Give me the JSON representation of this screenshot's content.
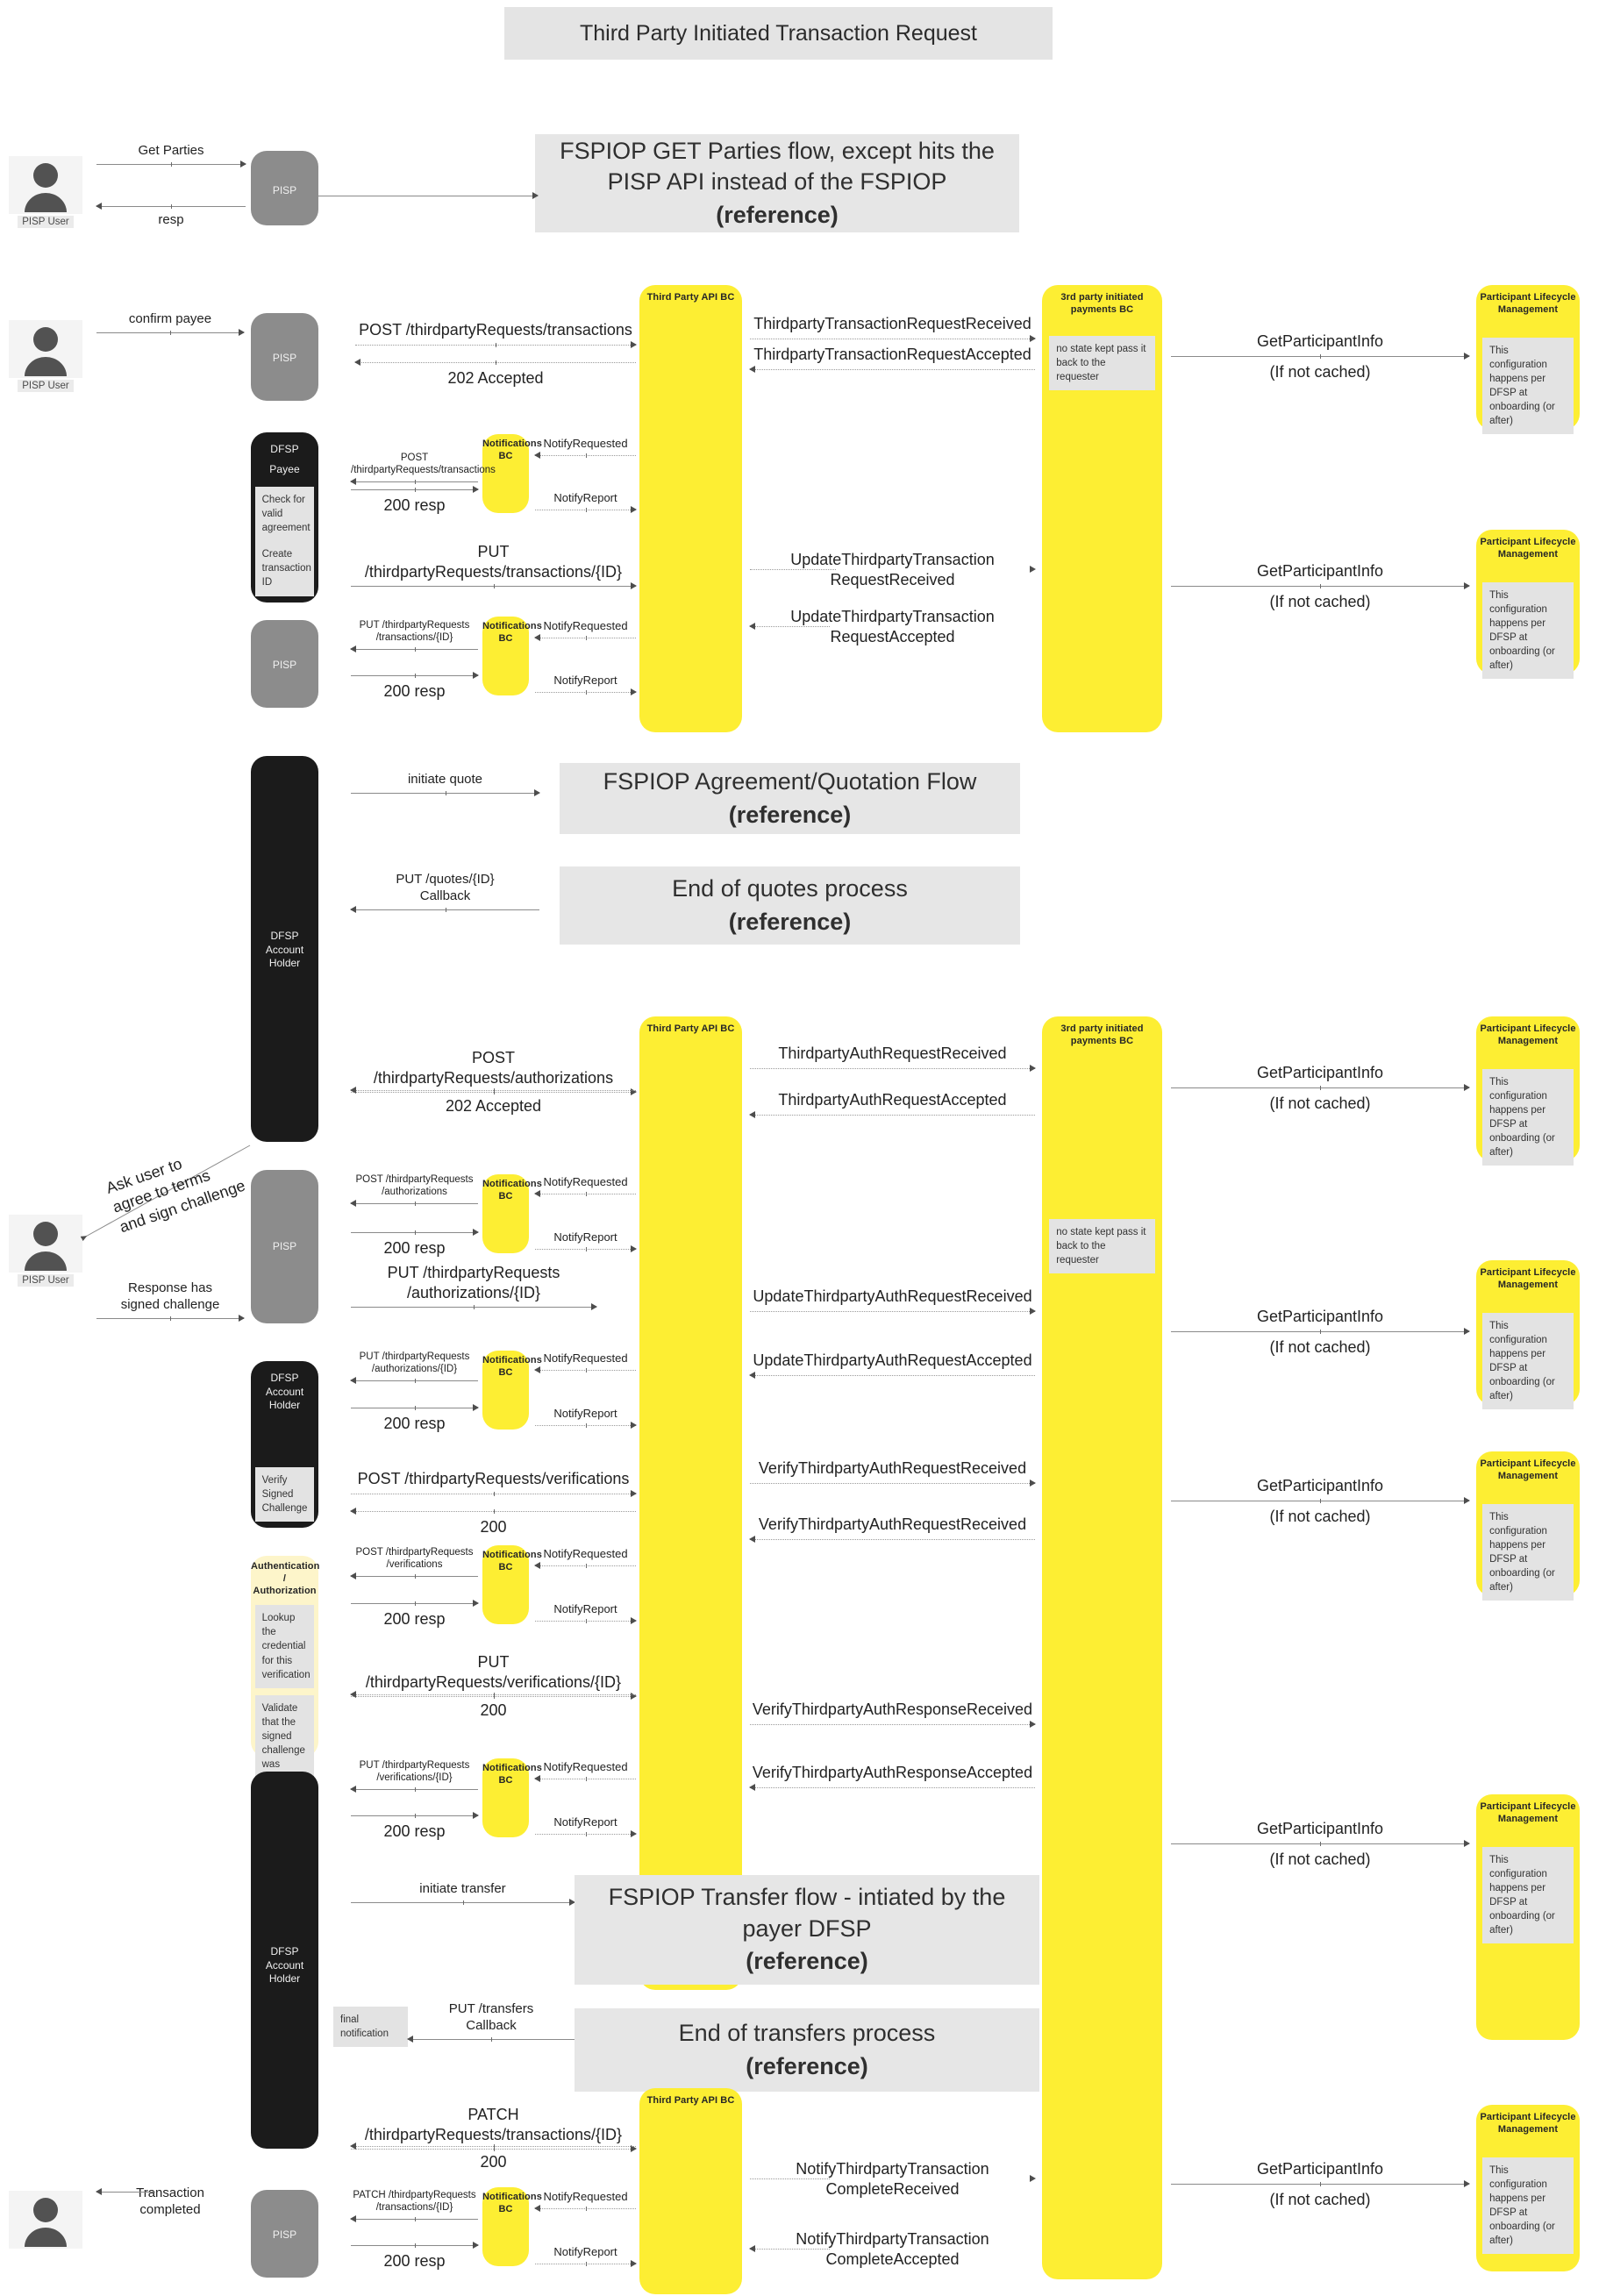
{
  "diagram": {
    "title": "Third Party Initiated Transaction Request",
    "type": "sequence-diagram"
  },
  "actors": {
    "pisp_user": "PISP User",
    "pisp": "PISP",
    "dfsp_payee_line1": "DFSP",
    "dfsp_payee_line2": "Payee",
    "dfsp_account_holder_line1": "DFSP",
    "dfsp_account_holder_line2": "Account Holder",
    "third_party_api_bc": "Third Party API BC",
    "third_party_payments_bc": "3rd party initiated payments BC",
    "notifications_bc": "Notifications BC",
    "participant_lifecycle": "Participant Lifecycle Management",
    "auth_authorization": "Authentication / Authorization"
  },
  "notes": {
    "check_agreement": "Check for valid agreement",
    "create_transaction_id": "Create transaction ID",
    "no_state_kept": "no state kept pass it back to the requester",
    "plm_config_a": "This configuration happens per DFSP at onboarding (or after)",
    "plm_config_b": "This configuration happens per DFSP at onboarding (or after)",
    "verify_signed_challenge": "Verify Signed Challenge",
    "lookup_credential": "Lookup the credential for this verification",
    "validate_signed": "Validate that the signed challenge was signed by the private key on the user's device",
    "final_notification": "final notification"
  },
  "references": {
    "get_parties": {
      "text": "FSPIOP GET Parties flow, except hits the PISP API instead of the FSPIOP",
      "bold": "(reference)"
    },
    "quotation": {
      "text": "FSPIOP Agreement/Quotation Flow",
      "bold": "(reference)"
    },
    "end_quotes": {
      "text": "End of quotes process",
      "bold": "(reference)"
    },
    "transfer": {
      "text": "FSPIOP Transfer flow - intiated by the payer DFSP",
      "bold": "(reference)"
    },
    "end_transfers": {
      "text": "End of transfers process",
      "bold": "(reference)"
    }
  },
  "messages": {
    "get_parties": "Get Parties",
    "resp": "resp",
    "confirm_payee": "confirm payee",
    "post_tpr_transactions": "POST /thirdpartyRequests/transactions",
    "accepted_202": "202 Accepted",
    "tptrr_received": "ThirdpartyTransactionRequestReceived",
    "tptrr_accepted": "ThirdpartyTransactionRequestAccepted",
    "get_participant_info": "GetParticipantInfo",
    "if_not_cached": "(If not cached)",
    "post_tpr_transactions_sm": "POST /thirdpartyRequests/transactions",
    "resp_200": "200 resp",
    "notify_requested": "NotifyRequested",
    "notify_report": "NotifyReport",
    "put_tpr_transactions_id": "PUT /thirdpartyRequests/transactions/{ID}",
    "update_tptr_received": "UpdateThirdpartyTransaction\nRequestReceived",
    "update_tptr_accepted": "UpdateThirdpartyTransaction\nRequestAccepted",
    "put_tpr_transactions_id_wrap": "PUT /thirdpartyRequests\n/transactions/{ID}",
    "initiate_quote": "initiate quote",
    "put_quotes_callback": "PUT /quotes/{ID}\nCallback",
    "post_tpr_authorizations": "POST /thirdpartyRequests/authorizations",
    "tp_auth_req_received": "ThirdpartyAuthRequestReceived",
    "tp_auth_req_accepted": "ThirdpartyAuthRequestAccepted",
    "post_tpr_authorizations_wrap": "POST /thirdpartyRequests\n/authorizations",
    "ask_user": "Ask user to\nagree to terms\nand sign challenge",
    "response_signed": "Response has\nsigned challenge",
    "put_tpr_authorizations_id": "PUT /thirdpartyRequests\n/authorizations/{ID}",
    "update_tp_auth_received": "UpdateThirdpartyAuthRequestReceived",
    "update_tp_auth_accepted": "UpdateThirdpartyAuthRequestAccepted",
    "put_tpr_authorizations_id2": "PUT /thirdpartyRequests\n/authorizations/{ID}",
    "post_tpr_verifications": "POST /thirdpartyRequests/verifications",
    "code_200": "200",
    "verify_tp_auth_req_received_1": "VerifyThirdpartyAuthRequestReceived",
    "verify_tp_auth_req_received_2": "VerifyThirdpartyAuthRequestReceived",
    "post_tpr_verifications_wrap": "POST /thirdpartyRequests\n/verifications",
    "put_tpr_verifications_id": "PUT /thirdpartyRequests/verifications/{ID}",
    "verify_tp_auth_resp_received": "VerifyThirdpartyAuthResponseReceived",
    "verify_tp_auth_resp_accepted": "VerifyThirdpartyAuthResponseAccepted",
    "put_tpr_verifications_id_wrap": "PUT /thirdpartyRequests\n/verifications/{ID}",
    "initiate_transfer": "initiate transfer",
    "put_transfers_callback": "PUT /transfers\nCallback",
    "patch_tpr_transactions_id": "PATCH /thirdpartyRequests/transactions/{ID}",
    "patch_tpr_transactions_id_wrap": "PATCH /thirdpartyRequests\n/transactions/{ID}",
    "notify_tptc_received": "NotifyThirdpartyTransaction\nCompleteReceived",
    "notify_tptc_accepted": "NotifyThirdpartyTransaction\nCompleteAccepted",
    "transaction_completed": "Transaction\ncompleted"
  },
  "colors": {
    "yellow": "#fdee33",
    "pale_yellow": "#fdf5ca",
    "grey_lane": "#8c8c8c",
    "black_lane": "#1b1b1b",
    "note_grey": "#e3e3e3",
    "reference_grey": "#e6e6e6"
  }
}
